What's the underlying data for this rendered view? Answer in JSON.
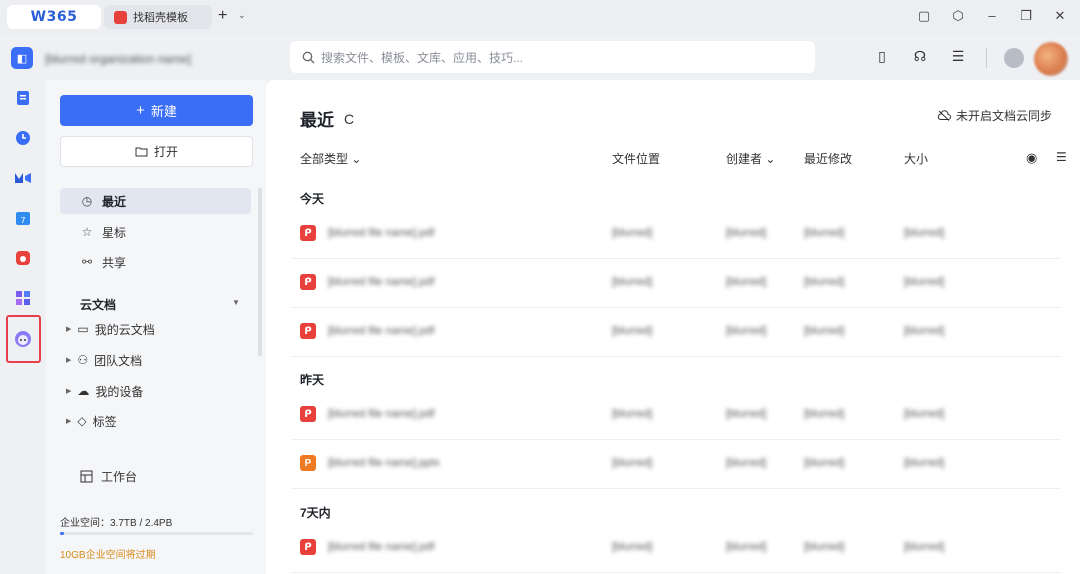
{
  "titlebar": {
    "app_name": "W365",
    "tab_label": "找稻壳模板",
    "add_tab": "+",
    "tab_dropdown": "⌄",
    "window_buttons": [
      "▢",
      "⬡",
      "–",
      "❐",
      "✕"
    ]
  },
  "appbar": {
    "org_logo_text": "◧",
    "org_name": "[blurred organization name]",
    "search_placeholder": "搜索文件、模板、文库、应用、技巧...",
    "tool_icons": [
      "▯",
      "☊",
      "☰"
    ]
  },
  "sidebar": {
    "new_label": "新建",
    "open_label": "打开",
    "nav": [
      {
        "label": "最近",
        "icon": "clock-icon",
        "glyph": "◷"
      },
      {
        "label": "星标",
        "icon": "star-icon",
        "glyph": "☆"
      },
      {
        "label": "共享",
        "icon": "share-icon",
        "glyph": "⚯"
      }
    ],
    "cloud_section": "云文档",
    "tree": [
      {
        "label": "我的云文档",
        "icon": "folder-icon",
        "glyph": "▭"
      },
      {
        "label": "团队文档",
        "icon": "team-icon",
        "glyph": "⚇"
      },
      {
        "label": "我的设备",
        "icon": "device-cloud-icon",
        "glyph": "☁"
      },
      {
        "label": "标签",
        "icon": "tag-icon",
        "glyph": "◇"
      }
    ],
    "workbench": "工作台",
    "storage_text": "企业空间：3.7TB / 2.4PB",
    "storage_fraction": 0.02,
    "expire_text": "10GB企业空间将过期"
  },
  "main": {
    "title": "最近",
    "sync_text": "未开启文档云同步",
    "columns": {
      "type": "全部类型 ⌄",
      "location": "文件位置",
      "creator": "创建者 ⌄",
      "modified": "最近修改",
      "size": "大小"
    },
    "groups": [
      {
        "label": "今天",
        "rows": [
          {
            "type": "pdf",
            "name": "[blurred file name].pdf",
            "location": "[blurred]",
            "creator": "[blurred]",
            "modified": "[blurred]",
            "size": "[blurred]"
          },
          {
            "type": "pdf",
            "name": "[blurred file name].pdf",
            "location": "[blurred]",
            "creator": "[blurred]",
            "modified": "[blurred]",
            "size": "[blurred]"
          },
          {
            "type": "pdf",
            "name": "[blurred file name].pdf",
            "location": "[blurred]",
            "creator": "[blurred]",
            "modified": "[blurred]",
            "size": "[blurred]"
          }
        ]
      },
      {
        "label": "昨天",
        "rows": [
          {
            "type": "pdf",
            "name": "[blurred file name].pdf",
            "location": "[blurred]",
            "creator": "[blurred]",
            "modified": "[blurred]",
            "size": "[blurred]"
          },
          {
            "type": "ppt",
            "name": "[blurred file name].pptx",
            "location": "[blurred]",
            "creator": "[blurred]",
            "modified": "[blurred]",
            "size": "[blurred]"
          }
        ]
      },
      {
        "label": "7天内",
        "rows": [
          {
            "type": "pdf",
            "name": "[blurred file name].pdf",
            "location": "[blurred]",
            "creator": "[blurred]",
            "modified": "[blurred]",
            "size": "[blurred]"
          }
        ]
      }
    ]
  },
  "colors": {
    "accent": "#3b6ef6",
    "pdf": "#e8403a",
    "ppt": "#f07a22",
    "highlight": "#e8404a",
    "warning": "#d88a1a"
  }
}
